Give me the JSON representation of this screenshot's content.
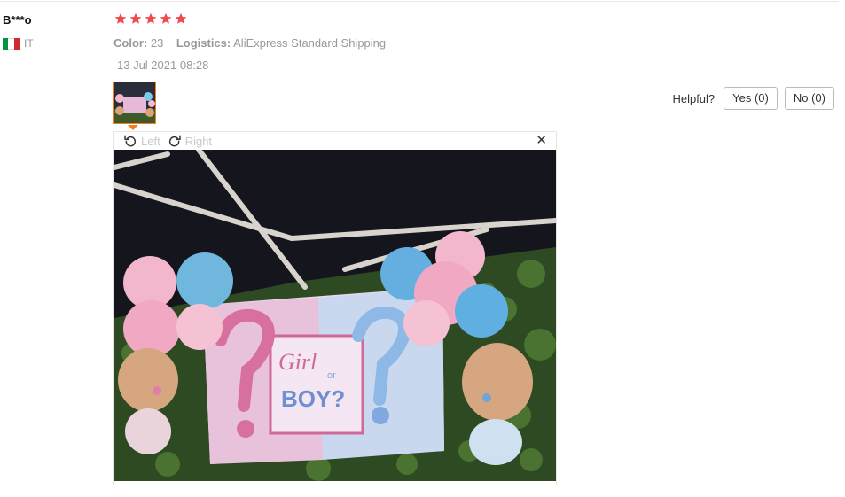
{
  "reviewer": {
    "name": "B***o",
    "country": "IT",
    "flag_colors": [
      "#009246",
      "#ffffff",
      "#ce2b37"
    ]
  },
  "review": {
    "rating": 5,
    "star_color": "#f04a4a",
    "color_label": "Color:",
    "color_value": "23",
    "logistics_label": "Logistics:",
    "logistics_value": "AliExpress Standard Shipping",
    "date": "13 Jul 2021 08:28"
  },
  "helpful": {
    "label": "Helpful?",
    "yes": "Yes (0)",
    "no": "No (0)"
  },
  "viewer": {
    "rotate_left": "Left",
    "rotate_right": "Right",
    "close_glyph": "✕",
    "photo_text_1": "Girl",
    "photo_text_or": "or",
    "photo_text_2": "BOY?"
  }
}
